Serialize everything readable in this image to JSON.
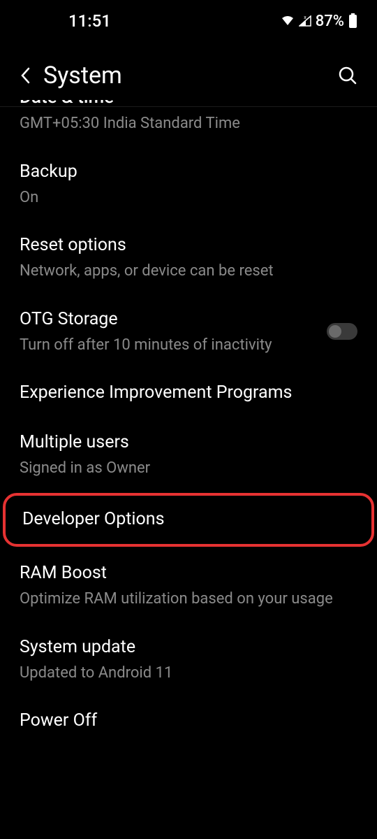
{
  "status": {
    "time": "11:51",
    "battery": "87%"
  },
  "header": {
    "title": "System"
  },
  "settings": {
    "datetime": {
      "title": "Date & time",
      "subtitle": "GMT+05:30 India Standard Time"
    },
    "backup": {
      "title": "Backup",
      "subtitle": "On"
    },
    "reset": {
      "title": "Reset options",
      "subtitle": "Network, apps, or device can be reset"
    },
    "otg": {
      "title": "OTG Storage",
      "subtitle": "Turn off after 10 minutes of inactivity"
    },
    "eip": {
      "title": "Experience Improvement Programs"
    },
    "users": {
      "title": "Multiple users",
      "subtitle": "Signed in as Owner"
    },
    "developer": {
      "title": "Developer Options"
    },
    "ramboost": {
      "title": "RAM Boost",
      "subtitle": "Optimize RAM utilization based on your usage"
    },
    "update": {
      "title": "System update",
      "subtitle": "Updated to Android 11"
    },
    "poweroff": {
      "title": "Power Off"
    }
  }
}
